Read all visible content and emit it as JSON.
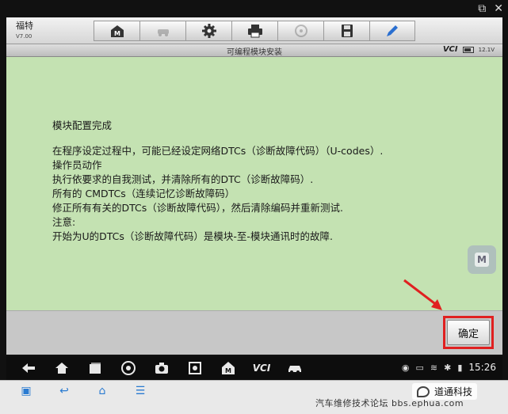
{
  "window": {
    "external_icon": "external-link-icon",
    "close_icon": "close-icon"
  },
  "header": {
    "brand_name": "福特",
    "version": "V7.00",
    "toolbar": [
      {
        "name": "home",
        "icon": "home-m-icon",
        "enabled": true
      },
      {
        "name": "vehicle-swap",
        "icon": "car-swap-icon",
        "enabled": false
      },
      {
        "name": "settings",
        "icon": "gear-icon",
        "enabled": true
      },
      {
        "name": "print",
        "icon": "printer-icon",
        "enabled": true
      },
      {
        "name": "help",
        "icon": "help-icon",
        "enabled": false
      },
      {
        "name": "save",
        "icon": "save-icon",
        "enabled": true
      },
      {
        "name": "notes",
        "icon": "pen-icon",
        "enabled": true
      }
    ]
  },
  "titlebar": {
    "title": "可编程模块安装",
    "vci": "VCI",
    "voltage": "12.1V"
  },
  "message": {
    "heading": "模块配置完成",
    "lines": [
      "在程序设定过程中，可能已经设定网络DTCs（诊断故障代码）（U-codes）.",
      "操作员动作",
      "执行依要求的自我测试，并清除所有的DTC（诊断故障码）.",
      "所有的 CMDTCs（连续记忆诊断故障码）",
      "修正所有有关的DTCs（诊断故障代码），然后清除编码并重新测试.",
      "注意:",
      "开始为U的DTCs（诊断故障代码）是模块-至-模块通讯时的故障."
    ]
  },
  "floating_button": {
    "label": "M"
  },
  "footer": {
    "ok_label": "确定",
    "highlight_color": "#e02020"
  },
  "navbar": {
    "icons": [
      "back-icon",
      "home-icon",
      "recent-apps-icon",
      "chrome-icon",
      "camera-icon",
      "brightness-icon",
      "maxisys-icon",
      "vci-icon",
      "car-icon"
    ],
    "vci_text": "VCI",
    "time": "15:26"
  },
  "device_bar": {
    "watermark_forum": "汽车维修技术论坛 bbs.ephua.com",
    "watermark_brand": "道通科技"
  }
}
